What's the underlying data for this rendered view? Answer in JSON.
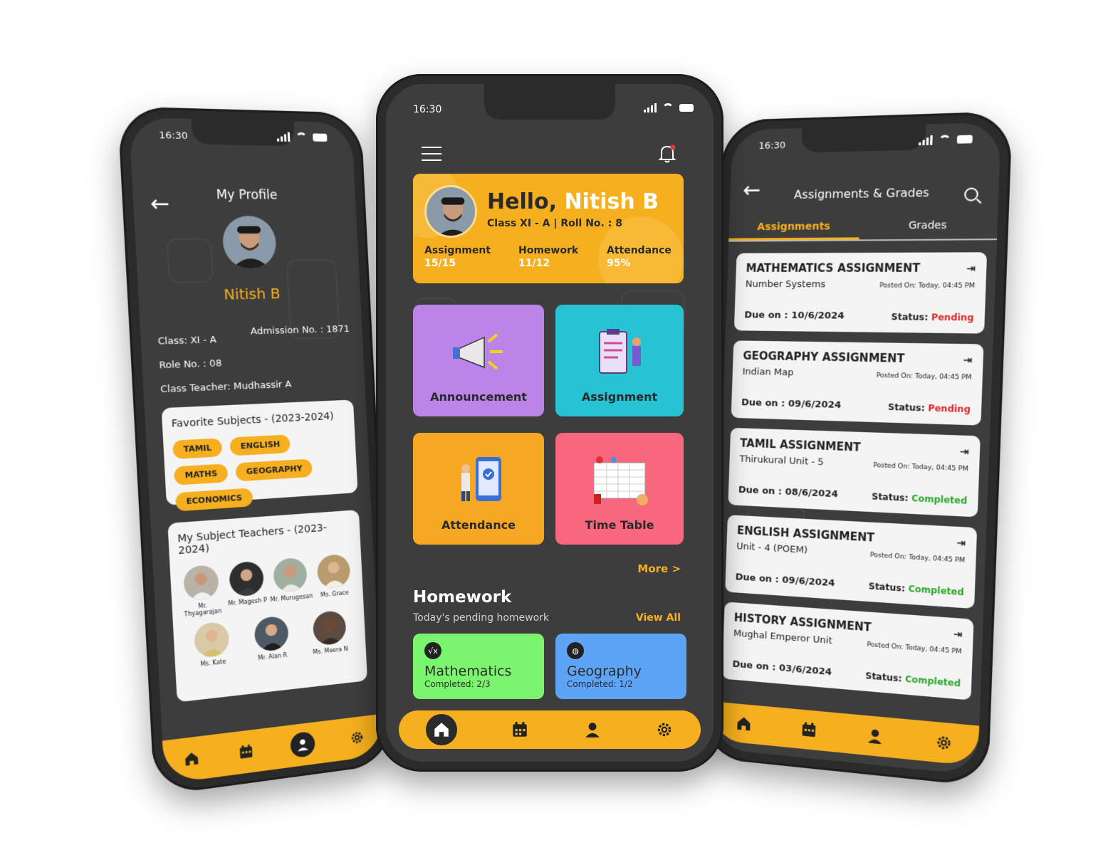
{
  "status_time": "16:30",
  "colors": {
    "accent": "#f6b01f",
    "screen_bg": "#3d3d3d",
    "card_bg": "#f4f4f4",
    "pending": "#e02828",
    "completed": "#2aa82a"
  },
  "profile": {
    "title": "My Profile",
    "name": "Nitish B",
    "class": "Class: XI - A",
    "admission": "Admission No. : 1871",
    "roll": "Role No. : 08",
    "class_teacher": "Class Teacher: Mudhassir A",
    "favorite_title": "Favorite Subjects - (2023-2024)",
    "favorite_subjects": [
      "TAMIL",
      "ENGLISH",
      "MATHS",
      "GEOGRAPHY",
      "ECONOMICS"
    ],
    "teachers_title": "My Subject Teachers - (2023-2024)",
    "teachers": [
      "Mr. Thyagarajan",
      "Mr. Magesh P",
      "Mr. Murugesan",
      "Ms. Grace",
      "Ms. Kate",
      "Mr. Alan R",
      "Ms. Meera N"
    ]
  },
  "home": {
    "greeting": "Hello,",
    "name": "Nitish B",
    "class_roll": "Class XI - A | Roll No. : 8",
    "stats": [
      {
        "label": "Assignment",
        "value": "15/15"
      },
      {
        "label": "Homework",
        "value": "11/12"
      },
      {
        "label": "Attendance",
        "value": "95%"
      }
    ],
    "tiles": [
      "Announcement",
      "Assignment",
      "Attendance",
      "Time Table"
    ],
    "more": "More >",
    "homework_title": "Homework",
    "homework_sub": "Today's pending homework",
    "view_all": "View All",
    "homework": [
      {
        "subject": "Mathematics",
        "completed": "Completed: 2/3"
      },
      {
        "subject": "Geography",
        "completed": "Completed: 1/2"
      }
    ]
  },
  "assignments": {
    "title": "Assignments & Grades",
    "tabs": [
      "Assignments",
      "Grades"
    ],
    "items": [
      {
        "title": "MATHEMATICS ASSIGNMENT",
        "topic": "Number Systems",
        "posted": "Posted On: Today, 04:45 PM",
        "due": "Due on : 10/6/2024",
        "status_label": "Status:",
        "status": "Pending"
      },
      {
        "title": "GEOGRAPHY ASSIGNMENT",
        "topic": "Indian Map",
        "posted": "Posted On: Today, 04:45 PM",
        "due": "Due on : 09/6/2024",
        "status_label": "Status:",
        "status": "Pending"
      },
      {
        "title": "TAMIL ASSIGNMENT",
        "topic": "Thirukural Unit - 5",
        "posted": "Posted On: Today, 04:45 PM",
        "due": "Due on : 08/6/2024",
        "status_label": "Status:",
        "status": "Completed"
      },
      {
        "title": "ENGLISH ASSIGNMENT",
        "topic": "Unit - 4 (POEM)",
        "posted": "Posted On: Today, 04:45 PM",
        "due": "Due on : 09/6/2024",
        "status_label": "Status:",
        "status": "Completed"
      },
      {
        "title": "HISTORY ASSIGNMENT",
        "topic": "Mughal Emperor Unit",
        "posted": "Posted On: Today, 04:45 PM",
        "due": "Due on : 03/6/2024",
        "status_label": "Status:",
        "status": "Completed"
      }
    ]
  },
  "nav_icons": [
    "home-icon",
    "calendar-icon",
    "profile-icon",
    "settings-icon"
  ]
}
